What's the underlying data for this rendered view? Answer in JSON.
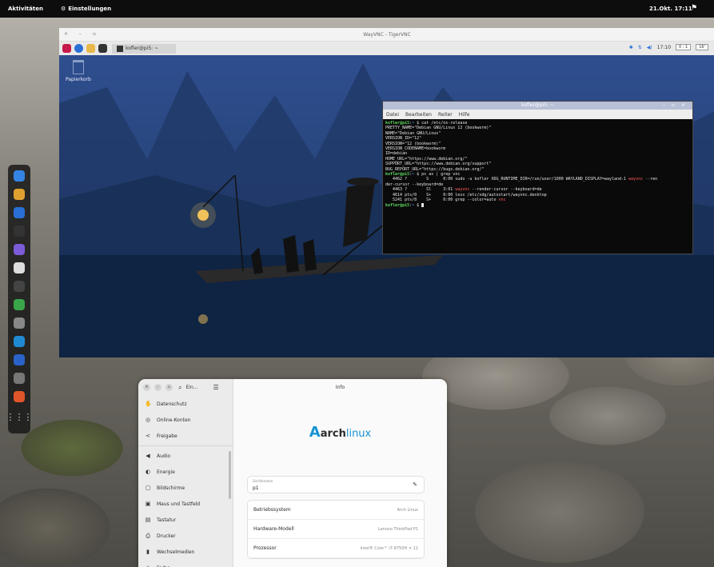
{
  "topbar": {
    "activities": "Aktivitäten",
    "app_name": "Einstellungen",
    "clock": "21.Okt. 17:11"
  },
  "vnc": {
    "title": "WayVNC - TigerVNC",
    "window_controls": "× – ▫",
    "taskbar_item": "kofler@pi5: ~",
    "panel_time": "17:10",
    "panel_box1": "0 : 1",
    "panel_box2": "16'"
  },
  "pi_desktop": {
    "trash_label": "Papierkorb"
  },
  "terminal": {
    "title": "kofler@pi5: ~",
    "menu": [
      "Datei",
      "Bearbeiten",
      "Reiter",
      "Hilfe"
    ],
    "lines": [
      {
        "prompt": "kofler@pi5",
        "path": "~",
        "cmd": " $ cat /etc/os-release"
      },
      {
        "text": "PRETTY_NAME=\"Debian GNU/Linux 12 (bookworm)\""
      },
      {
        "text": "NAME=\"Debian GNU/Linux\""
      },
      {
        "text": "VERSION_ID=\"12\""
      },
      {
        "text": "VERSION=\"12 (bookworm)\""
      },
      {
        "text": "VERSION_CODENAME=bookworm"
      },
      {
        "text": "ID=debian"
      },
      {
        "text": "HOME_URL=\"https://www.debian.org/\""
      },
      {
        "text": "SUPPORT_URL=\"https://www.debian.org/support\""
      },
      {
        "text": "BUG_REPORT_URL=\"https://bugs.debian.org/\""
      },
      {
        "prompt": "kofler@pi5",
        "path": "~",
        "cmd": " $ ps ax | grep vnc"
      },
      {
        "text": "   4462 ?        S      0:00 sudo -u kofler XDG_RUNTIME_DIR=/run/user/1000 WAYLAND_DISPLAY=wayland-1 ",
        "hl": "wayvnc",
        "tail": " --ren"
      },
      {
        "text": "der-cursor --keyboard=de"
      },
      {
        "text": "   4463 ?        Sl     3:01 ",
        "hl": "wayvnc",
        "tail": " --render-cursor --keyboard=de"
      },
      {
        "text": "   4614 pts/0    S+     0:00 less /etc/xdg/autostart/wayvnc.desktop"
      },
      {
        "text": "   5241 pts/8    S+     0:00 grep --color=auto ",
        "hl": "vnc",
        "tail": ""
      },
      {
        "prompt": "kofler@pi5",
        "path": "~",
        "cmd": " $ ",
        "cursor": true
      }
    ]
  },
  "dash": {
    "items": [
      {
        "name": "dash-item-files-icon",
        "color": "#3584e4"
      },
      {
        "name": "dash-item-chrome-icon",
        "color": "#e0a030"
      },
      {
        "name": "dash-item-thunderbird-icon",
        "color": "#2a6fd6"
      },
      {
        "name": "dash-item-terminal-icon",
        "color": "#333333"
      },
      {
        "name": "dash-item-emacs-icon",
        "color": "#7b5bd6"
      },
      {
        "name": "dash-item-settings-icon",
        "color": "#dddddd"
      },
      {
        "name": "dash-item-screenshot-icon",
        "color": "#444444"
      },
      {
        "name": "dash-item-spreadsheet-icon",
        "color": "#3aa548"
      },
      {
        "name": "dash-item-remmina-icon",
        "color": "#888888"
      },
      {
        "name": "dash-item-vscode-icon",
        "color": "#1f8ad2"
      },
      {
        "name": "dash-item-photos-icon",
        "color": "#2a62c8"
      },
      {
        "name": "dash-item-cable-icon",
        "color": "#777777"
      },
      {
        "name": "dash-item-paint-icon",
        "color": "#e0562a"
      }
    ],
    "grid_label": "⋮⋮⋮"
  },
  "settings": {
    "search_label": "Ein...",
    "title": "Info",
    "sidebar_items": [
      {
        "icon": "✋",
        "label": "Datenschutz"
      },
      {
        "icon": "◎",
        "label": "Online-Konten"
      },
      {
        "icon": "<",
        "label": "Freigabe"
      },
      {
        "sep": true
      },
      {
        "icon": "◀",
        "label": "Audio"
      },
      {
        "icon": "◐",
        "label": "Energie"
      },
      {
        "icon": "▢",
        "label": "Bildschirme"
      },
      {
        "icon": "▣",
        "label": "Maus und Tastfeld"
      },
      {
        "icon": "▤",
        "label": "Tastatur"
      },
      {
        "icon": "⎙",
        "label": "Drucker"
      },
      {
        "icon": "▮",
        "label": "Wechselmedien"
      },
      {
        "icon": "◈",
        "label": "Farbe"
      }
    ],
    "logo_text_bold": "arch",
    "logo_text": "linux",
    "logo_letter": "A",
    "hostname_label": "Gerätename",
    "hostname_value": "p1",
    "info_rows": [
      {
        "key": "Betriebssystem",
        "value": "Arch Linux"
      },
      {
        "key": "Hardware-Modell",
        "value": "Lenovo ThinkPad P1"
      },
      {
        "key": "Prozessor",
        "value": "Intel® Core™ i7-8750H × 12"
      }
    ]
  }
}
